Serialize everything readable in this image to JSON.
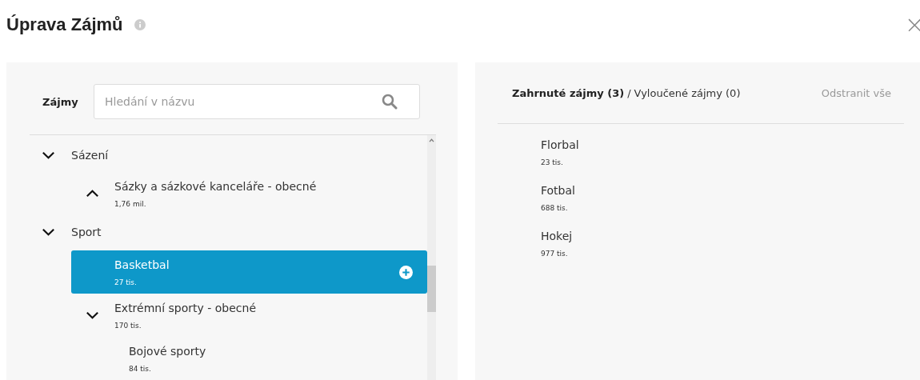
{
  "dialog": {
    "title": "Úprava Zájmů",
    "close": "×"
  },
  "picker": {
    "label": "Zájmy",
    "search": {
      "placeholder": "Hledání v názvu"
    },
    "tree": [
      {
        "name": "Sázení",
        "expanded": true,
        "selected": false,
        "children": [
          {
            "name": "Sázky a sázkové kanceláře - obecné",
            "count": "1,76 mil.",
            "expanded": false,
            "selected": false
          }
        ]
      },
      {
        "name": "Sport",
        "expanded": true,
        "selected": false,
        "children": [
          {
            "name": "Basketbal",
            "count": "27 tis.",
            "selected": true
          },
          {
            "name": "Extrémní sporty - obecné",
            "count": "170 tis.",
            "expanded": true,
            "selected": false,
            "children": [
              {
                "name": "Bojové sporty",
                "count": "84 tis.",
                "selected": false
              }
            ]
          }
        ]
      }
    ]
  },
  "selection": {
    "tabs": [
      {
        "label": "Zahrnuté zájmy (3)",
        "selected": true
      },
      {
        "label": "Vyloučené zájmy (0)",
        "selected": false
      }
    ],
    "separator": "/",
    "remove_all": "Odstranit vše",
    "items": [
      {
        "name": "Florbal",
        "count": "23 tis."
      },
      {
        "name": "Fotbal",
        "count": "688 tis."
      },
      {
        "name": "Hokej",
        "count": "977 tis."
      }
    ]
  }
}
